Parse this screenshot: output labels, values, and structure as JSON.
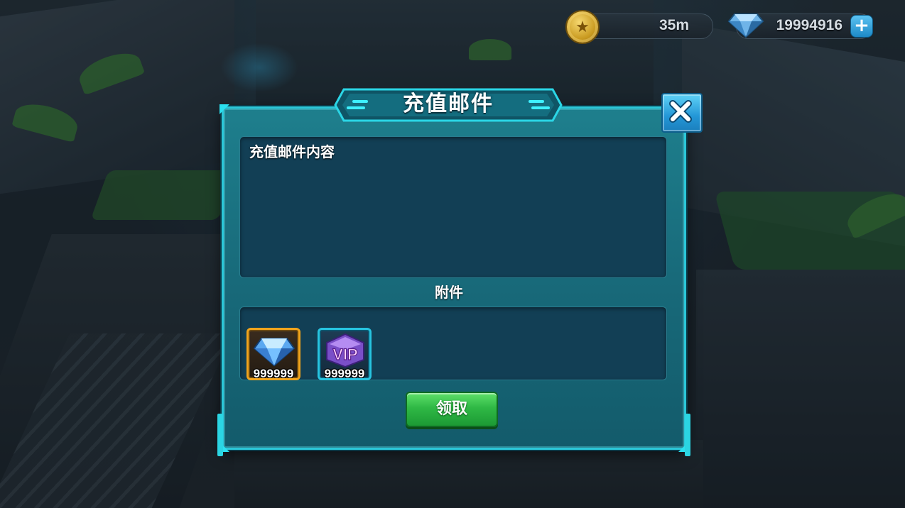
{
  "hud": {
    "coin_value": "35m",
    "gem_value": "19994916",
    "plus_label": "+"
  },
  "dialog": {
    "title": "充值邮件",
    "content": "充值邮件内容",
    "attachments_label": "附件",
    "attachments": [
      {
        "icon": "diamond-icon",
        "count": "999999"
      },
      {
        "icon": "vip-icon",
        "count": "999999"
      }
    ],
    "claim_label": "领取"
  },
  "colors": {
    "dialog_teal": "#1e7f8d",
    "dialog_border": "#2bc7d8",
    "claim_green": "#2fb845",
    "diamond_frame": "#f2a41c",
    "vip_frame": "#27c4e0"
  }
}
